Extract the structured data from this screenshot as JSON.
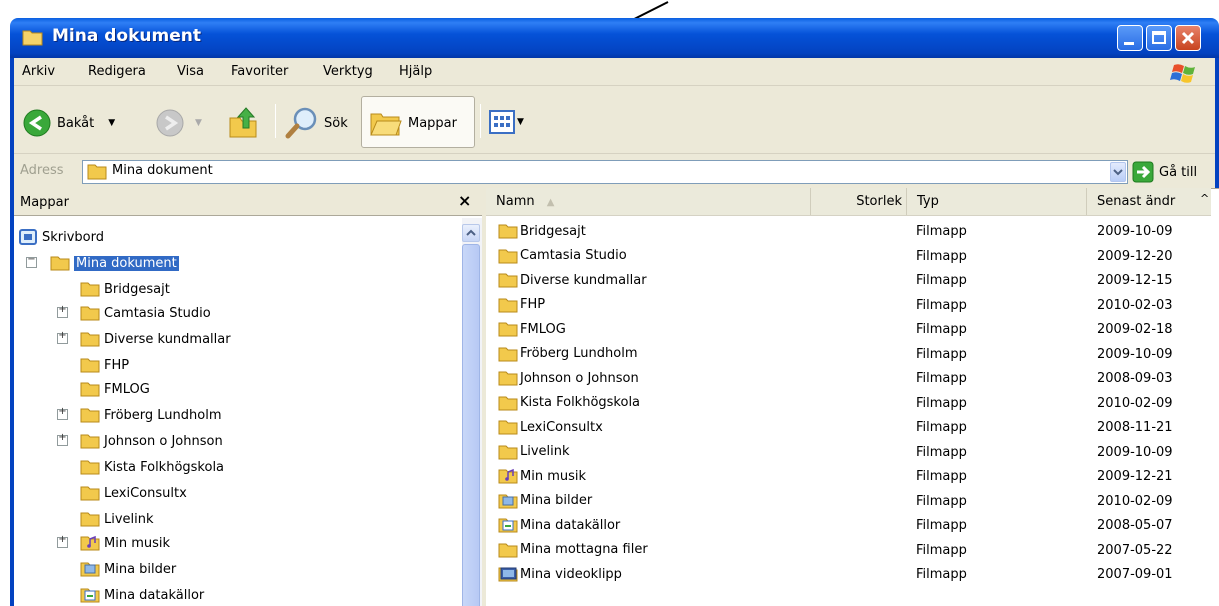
{
  "window": {
    "title": "Mina dokument"
  },
  "menu": [
    "Arkiv",
    "Redigera",
    "Visa",
    "Favoriter",
    "Verktyg",
    "Hjälp"
  ],
  "toolbar": {
    "back_label": "Bakåt",
    "search_label": "Sök",
    "folders_label": "Mappar"
  },
  "address": {
    "label": "Adress",
    "value": "Mina dokument",
    "go_label": "Gå till"
  },
  "folders_pane": {
    "title": "Mappar",
    "close_symbol": "×",
    "items": [
      {
        "label": "Skrivbord",
        "icon": "desktop-icon"
      },
      {
        "label": "Mina dokument",
        "icon": "folder-icon"
      },
      {
        "label": "Bridgesajt",
        "icon": "folder-icon"
      },
      {
        "label": "Camtasia Studio",
        "icon": "folder-icon"
      },
      {
        "label": "Diverse kundmallar",
        "icon": "folder-icon"
      },
      {
        "label": "FHP",
        "icon": "folder-icon"
      },
      {
        "label": "FMLOG",
        "icon": "folder-icon"
      },
      {
        "label": "Fröberg Lundholm",
        "icon": "folder-icon"
      },
      {
        "label": "Johnson o Johnson",
        "icon": "folder-icon"
      },
      {
        "label": "Kista Folkhögskola",
        "icon": "folder-icon"
      },
      {
        "label": "LexiConsultx",
        "icon": "folder-icon"
      },
      {
        "label": "Livelink",
        "icon": "folder-icon"
      },
      {
        "label": "Min musik",
        "icon": "music-folder-icon"
      },
      {
        "label": "Mina bilder",
        "icon": "pictures-folder-icon"
      },
      {
        "label": "Mina datakällor",
        "icon": "datasource-folder-icon"
      }
    ]
  },
  "list": {
    "columns": [
      "Namn",
      "Storlek",
      "Typ",
      "Senast ändr"
    ],
    "rows": [
      {
        "name": "Bridgesajt",
        "type": "Filmapp",
        "date": "2009-10-09"
      },
      {
        "name": "Camtasia Studio",
        "type": "Filmapp",
        "date": "2009-12-20"
      },
      {
        "name": "Diverse kundmallar",
        "type": "Filmapp",
        "date": "2009-12-15"
      },
      {
        "name": "FHP",
        "type": "Filmapp",
        "date": "2010-02-03"
      },
      {
        "name": "FMLOG",
        "type": "Filmapp",
        "date": "2009-02-18"
      },
      {
        "name": "Fröberg Lundholm",
        "type": "Filmapp",
        "date": "2009-10-09"
      },
      {
        "name": "Johnson o Johnson",
        "type": "Filmapp",
        "date": "2008-09-03"
      },
      {
        "name": "Kista Folkhögskola",
        "type": "Filmapp",
        "date": "2010-02-09"
      },
      {
        "name": "LexiConsultx",
        "type": "Filmapp",
        "date": "2008-11-21"
      },
      {
        "name": "Livelink",
        "type": "Filmapp",
        "date": "2009-10-09"
      },
      {
        "name": "Min musik",
        "type": "Filmapp",
        "date": "2009-12-21"
      },
      {
        "name": "Mina bilder",
        "type": "Filmapp",
        "date": "2010-02-09"
      },
      {
        "name": "Mina datakällor",
        "type": "Filmapp",
        "date": "2008-05-07"
      },
      {
        "name": "Mina mottagna filer",
        "type": "Filmapp",
        "date": "2007-05-22"
      },
      {
        "name": "Mina videoklipp",
        "type": "Filmapp",
        "date": "2007-09-01"
      }
    ]
  },
  "colors": {
    "titlebar": "#0342c0",
    "selection": "#316ac5",
    "folder": "#f2c94c"
  }
}
